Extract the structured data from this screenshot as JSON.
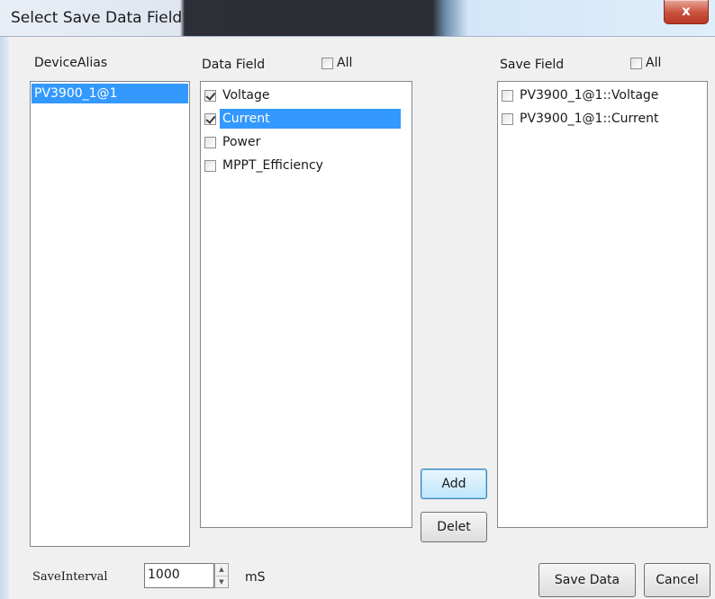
{
  "window": {
    "title": "Select Save Data Field",
    "close_glyph": "x"
  },
  "device_alias": {
    "header": "DeviceAlias",
    "items": [
      {
        "label": "PV3900_1@1",
        "selected": true
      }
    ]
  },
  "data_field": {
    "header": "Data Field",
    "all_label": "All",
    "all_checked": false,
    "items": [
      {
        "label": "Voltage",
        "checked": true,
        "selected": false
      },
      {
        "label": "Current",
        "checked": true,
        "selected": true
      },
      {
        "label": "Power",
        "checked": false,
        "selected": false
      },
      {
        "label": "MPPT_Efficiency",
        "checked": false,
        "selected": false
      }
    ]
  },
  "save_field": {
    "header": "Save Field",
    "all_label": "All",
    "all_checked": false,
    "items": [
      {
        "label": "PV3900_1@1::Voltage",
        "checked": false
      },
      {
        "label": "PV3900_1@1::Current",
        "checked": false
      }
    ]
  },
  "buttons": {
    "add": "Add",
    "delete": "Delet",
    "save_data": "Save Data",
    "cancel": "Cancel"
  },
  "save_interval": {
    "label": "SaveInterval",
    "value": "1000",
    "unit": "mS"
  },
  "icons": {
    "check": "checkmark-icon",
    "spin_up": "spin-up-icon",
    "spin_down": "spin-down-icon",
    "close": "close-icon"
  }
}
